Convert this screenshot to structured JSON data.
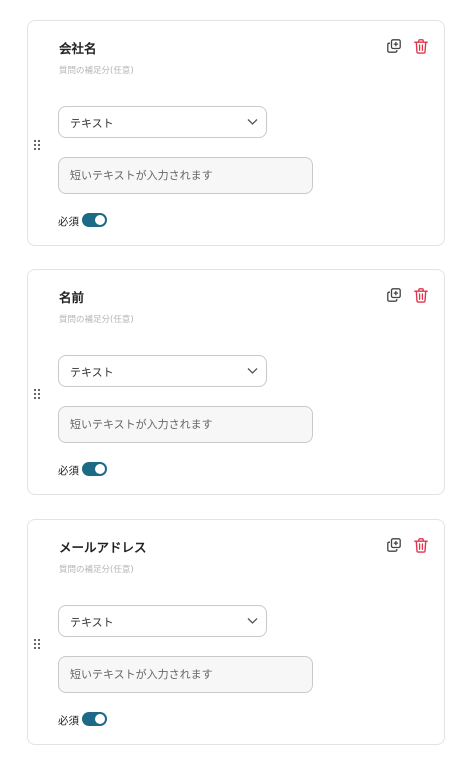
{
  "cards": [
    {
      "title": "会社名",
      "hint": "質問の補足分(任意)",
      "answer_type": "テキスト",
      "preview_placeholder": "短いテキストが入力されます",
      "required_label": "必須",
      "required": true
    },
    {
      "title": "名前",
      "hint": "質問の補足分(任意)",
      "answer_type": "テキスト",
      "preview_placeholder": "短いテキストが入力されます",
      "required_label": "必須",
      "required": true
    },
    {
      "title": "メールアドレス",
      "hint": "質問の補足分(任意)",
      "answer_type": "テキスト",
      "preview_placeholder": "短いテキストが入力されます",
      "required_label": "必須",
      "required": true
    }
  ],
  "icons": {
    "copy": "copy-icon",
    "delete": "trash-icon",
    "drag": "drag-handle-icon",
    "dropdown": "chevron-down-icon"
  },
  "colors": {
    "toggle_on": "#1d6a87",
    "delete_icon": "#e0344b",
    "copy_icon": "#444444",
    "hint_text": "#b4b4b4",
    "card_border": "#e3e3e3"
  }
}
